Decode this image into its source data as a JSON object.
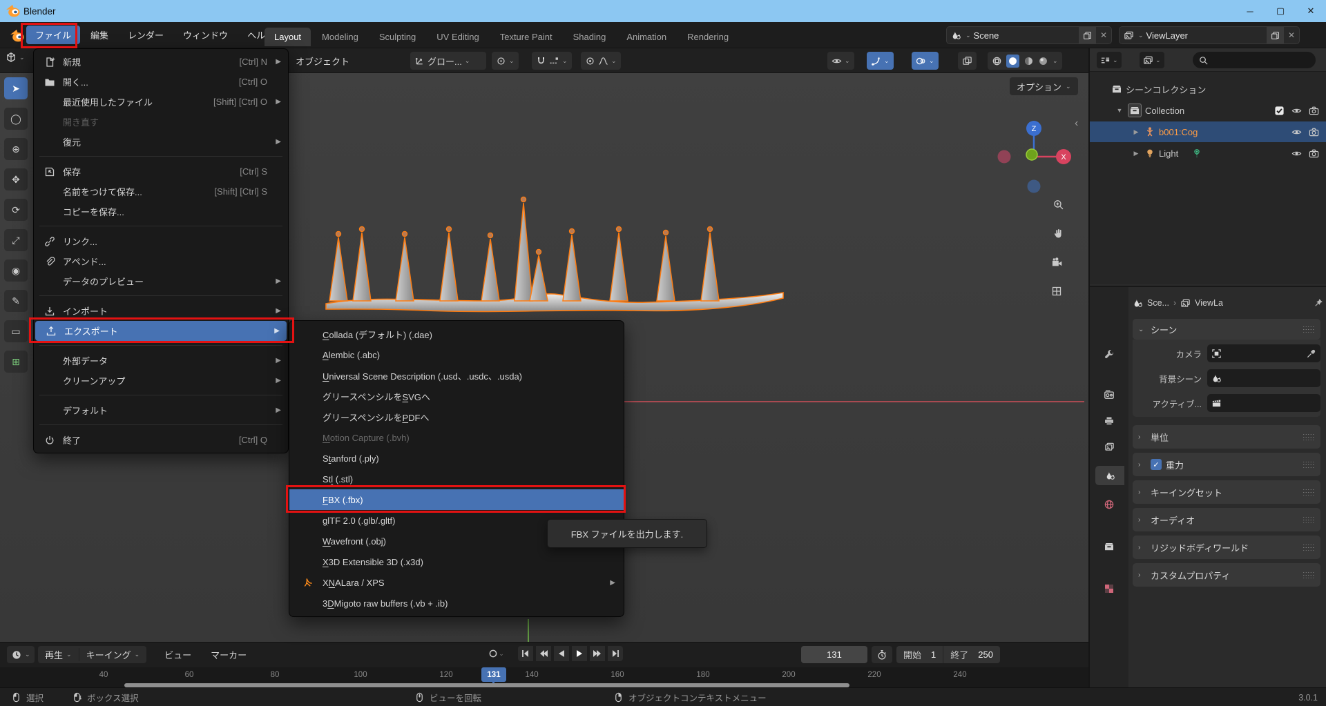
{
  "window": {
    "app_title": "Blender"
  },
  "colors": {
    "highlight": "#4772b3",
    "annotation_red": "#e31212",
    "selection_orange": "#ff7d12",
    "object_name_orange": "#ff9d45",
    "titlebar_blue": "#8cc7f2"
  },
  "topbar": {
    "menus": [
      {
        "label": "ファイル",
        "highlighted": true,
        "annotated": true
      },
      {
        "label": "編集"
      },
      {
        "label": "レンダー"
      },
      {
        "label": "ウィンドウ"
      },
      {
        "label": "ヘルプ"
      }
    ],
    "workspaces": [
      {
        "label": "Layout",
        "active": true
      },
      {
        "label": "Modeling"
      },
      {
        "label": "Sculpting"
      },
      {
        "label": "UV Editing"
      },
      {
        "label": "Texture Paint"
      },
      {
        "label": "Shading"
      },
      {
        "label": "Animation"
      },
      {
        "label": "Rendering"
      }
    ],
    "scene_selector": {
      "value": "Scene"
    },
    "view_layer_selector": {
      "value": "ViewLayer"
    }
  },
  "file_menu": {
    "items": [
      {
        "type": "item",
        "icon": "file-new",
        "label": "新規",
        "shortcut": "[Ctrl] N",
        "submenu": true
      },
      {
        "type": "item",
        "icon": "folder",
        "label": "開く...",
        "shortcut": "[Ctrl] O"
      },
      {
        "type": "item",
        "label": "最近使用したファイル",
        "shortcut": "[Shift] [Ctrl] O",
        "submenu": true
      },
      {
        "type": "item",
        "label": "開き直す",
        "disabled": true
      },
      {
        "type": "item",
        "label": "復元",
        "submenu": true
      },
      {
        "type": "sep"
      },
      {
        "type": "item",
        "icon": "save",
        "label": "保存",
        "shortcut": "[Ctrl] S"
      },
      {
        "type": "item",
        "label": "名前をつけて保存...",
        "shortcut": "[Shift] [Ctrl] S"
      },
      {
        "type": "item",
        "label": "コピーを保存..."
      },
      {
        "type": "sep"
      },
      {
        "type": "item",
        "icon": "link",
        "label": "リンク..."
      },
      {
        "type": "item",
        "icon": "append",
        "label": "アペンド..."
      },
      {
        "type": "item",
        "label": "データのプレビュー",
        "submenu": true
      },
      {
        "type": "sep"
      },
      {
        "type": "item",
        "icon": "import",
        "label": "インポート",
        "submenu": true
      },
      {
        "type": "item",
        "icon": "export",
        "label": "エクスポート",
        "submenu": true,
        "highlighted": true,
        "annotated": true
      },
      {
        "type": "sep"
      },
      {
        "type": "item",
        "label": "外部データ",
        "submenu": true
      },
      {
        "type": "item",
        "label": "クリーンアップ",
        "submenu": true
      },
      {
        "type": "sep"
      },
      {
        "type": "item",
        "label": "デフォルト",
        "submenu": true
      },
      {
        "type": "sep"
      },
      {
        "type": "item",
        "icon": "power",
        "label": "終了",
        "shortcut": "[Ctrl] Q"
      }
    ]
  },
  "export_submenu": {
    "items": [
      {
        "pre": "",
        "m": "C",
        "post": "ollada (デフォルト) (.dae)"
      },
      {
        "pre": "",
        "m": "A",
        "post": "lembic (.abc)"
      },
      {
        "pre": "",
        "m": "U",
        "post": "niversal Scene Description (.usd、.usdc、.usda)"
      },
      {
        "pre": "グリースペンシルを",
        "m": "S",
        "post": "VGへ"
      },
      {
        "pre": "グリースペンシルを",
        "m": "P",
        "post": "DFへ"
      },
      {
        "pre": "",
        "m": "M",
        "post": "otion Capture (.bvh)",
        "disabled": true
      },
      {
        "pre": "S",
        "m": "t",
        "post": "anford (.ply)"
      },
      {
        "pre": "St",
        "m": "l",
        "post": " (.stl)"
      },
      {
        "pre": "",
        "m": "F",
        "post": "BX (.fbx)",
        "highlighted": true,
        "annotated": true
      },
      {
        "pre": "",
        "m": "g",
        "post": "lTF 2.0 (.glb/.gltf)"
      },
      {
        "pre": "",
        "m": "W",
        "post": "avefront (.obj)"
      },
      {
        "pre": "",
        "m": "X",
        "post": "3D Extensible 3D (.x3d)"
      },
      {
        "pre": "X",
        "m": "N",
        "post": "ALara / XPS",
        "icon": "xna",
        "submenu": true
      },
      {
        "pre": "3",
        "m": "D",
        "post": "Migoto raw buffers (.vb + .ib)"
      }
    ]
  },
  "tooltip": {
    "text": "FBX ファイルを出力します."
  },
  "viewport": {
    "header": {
      "object_menu": "オブジェクト",
      "orientation": "グロー...",
      "options_button": "オプション"
    },
    "gizmo": {
      "x_label": "X",
      "z_label": "Z"
    },
    "collapse_arrow": "‹"
  },
  "toolbar": {
    "tools": [
      "tweak",
      "select-circle",
      "cursor",
      "move",
      "rotate",
      "scale",
      "transform",
      "annotate",
      "measure",
      "add-cube"
    ]
  },
  "outliner": {
    "rows": [
      {
        "icon": "collection",
        "label": "シーンコレクション",
        "indent": 0
      },
      {
        "icon": "collection",
        "label": "Collection",
        "indent": 1,
        "expander": "▼",
        "boxed": true,
        "toggles": [
          "checkbox",
          "eye",
          "camera"
        ]
      },
      {
        "icon": "armature",
        "label": "b001:Cog",
        "indent": 2,
        "expander": "▶",
        "selected": true,
        "orange": true,
        "toggles": [
          "eye",
          "camera"
        ]
      },
      {
        "icon": "light",
        "label": "Light",
        "indent": 2,
        "expander": "▶",
        "extra": "lightdata",
        "toggles": [
          "eye",
          "camera"
        ]
      }
    ]
  },
  "properties": {
    "breadcrumb": {
      "scene": "Sce...",
      "separator": "›",
      "view_layer": "ViewLa"
    },
    "scene_panel": {
      "title": "シーン",
      "fields": [
        {
          "label": "カメラ",
          "icon": "camframe",
          "trailing": "dropper"
        },
        {
          "label": "背景シーン",
          "icon": "droplet"
        },
        {
          "label": "アクティブ...",
          "icon": "clapper"
        }
      ]
    },
    "sections": [
      {
        "label": "単位"
      },
      {
        "label": "重力",
        "checkbox": true
      },
      {
        "label": "キーイングセット"
      },
      {
        "label": "オーディオ"
      },
      {
        "label": "リジッドボディワールド"
      },
      {
        "label": "カスタムプロパティ"
      }
    ]
  },
  "timeline": {
    "menus": [
      {
        "label": "再生",
        "dropdown": true
      },
      {
        "label": "キーイング",
        "dropdown": true
      },
      {
        "label": "ビュー"
      },
      {
        "label": "マーカー"
      }
    ],
    "current_frame": "131",
    "start": {
      "label": "開始",
      "value": "1"
    },
    "end": {
      "label": "終了",
      "value": "250"
    },
    "playhead": {
      "frame": "131"
    },
    "ticks": [
      "40",
      "60",
      "80",
      "100",
      "120",
      "140",
      "160",
      "180",
      "200",
      "220",
      "240"
    ]
  },
  "status_bar": {
    "hints": [
      {
        "icon": "mouse-left",
        "label": "選択"
      },
      {
        "icon": "mouse-drag",
        "label": "ボックス選択"
      },
      {
        "icon": "mouse-middle",
        "label": "ビューを回転"
      },
      {
        "icon": "mouse-right",
        "label": "オブジェクトコンテキストメニュー"
      }
    ],
    "version": "3.0.1"
  }
}
